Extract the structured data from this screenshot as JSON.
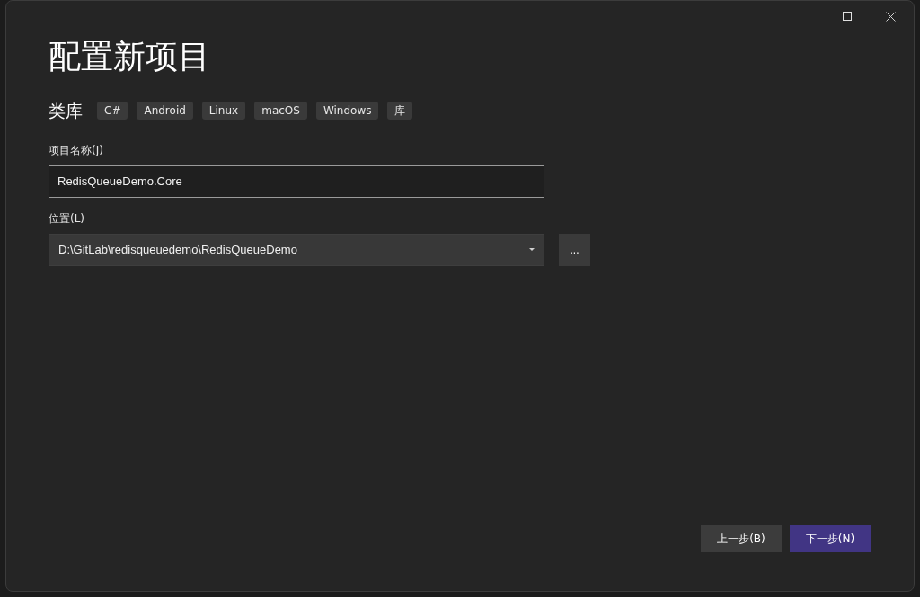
{
  "window": {
    "title": "配置新项目"
  },
  "template": {
    "name": "类库",
    "tags": [
      "C#",
      "Android",
      "Linux",
      "macOS",
      "Windows",
      "库"
    ]
  },
  "project_name": {
    "label": "项目名称(J)",
    "value": "RedisQueueDemo.Core"
  },
  "location": {
    "label": "位置(L)",
    "value": "D:\\GitLab\\redisqueuedemo\\RedisQueueDemo",
    "browse": "..."
  },
  "buttons": [
    {
      "label": "上一步(B)",
      "kind": "secondary"
    },
    {
      "label": "下一步(N)",
      "kind": "primary"
    }
  ]
}
